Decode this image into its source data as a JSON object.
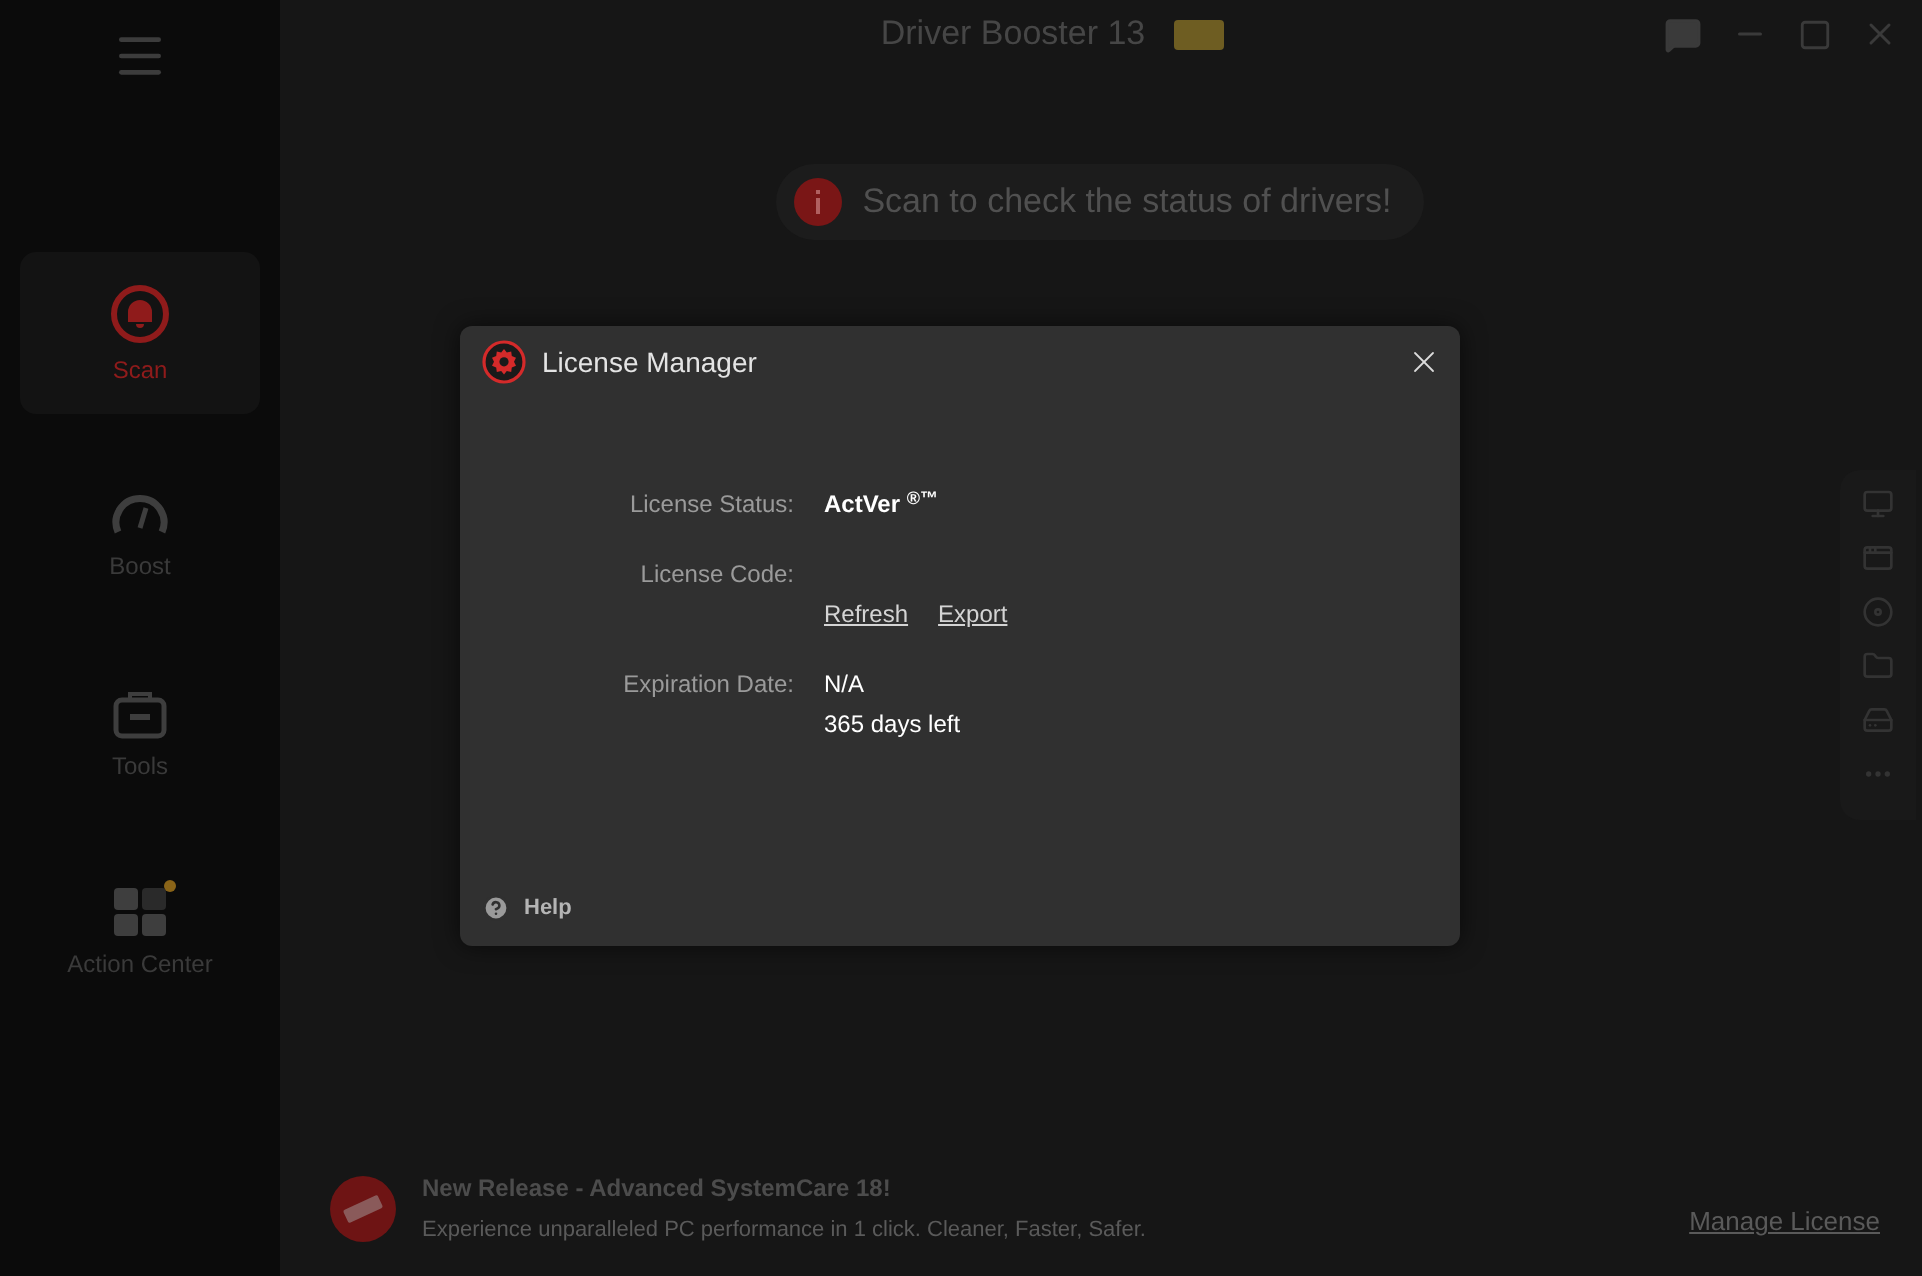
{
  "app": {
    "title": "Driver Booster 13"
  },
  "sidebar": {
    "items": [
      {
        "kind": "scan",
        "label": "Scan",
        "selected": true,
        "badge": false
      },
      {
        "kind": "boost",
        "label": "Boost",
        "selected": false,
        "badge": false
      },
      {
        "kind": "tools",
        "label": "Tools",
        "selected": false,
        "badge": false
      },
      {
        "kind": "action_center",
        "label": "Action Center",
        "selected": false,
        "badge": true
      }
    ]
  },
  "scan_prompt": {
    "text": "Scan to check the status of drivers!"
  },
  "promo": {
    "title": "New Release - Advanced SystemCare 18!",
    "subtitle": "Experience unparalleled PC performance in 1 click. Cleaner, Faster, Safer."
  },
  "manage_license": "Manage License",
  "dialog": {
    "title": "License Manager",
    "fields": [
      {
        "kind": "strong",
        "label": "License Status:",
        "value": "ActVer $^{®™}$"
      },
      {
        "kind": "links",
        "label": "License Code:",
        "links": [
          "Refresh",
          "Export"
        ]
      },
      {
        "kind": "lines",
        "label": "Expiration Date:",
        "lines": [
          "N/A",
          "365 days left"
        ]
      }
    ],
    "help": "Help"
  }
}
